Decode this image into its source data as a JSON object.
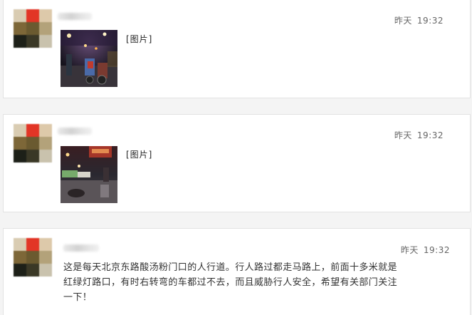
{
  "posts": [
    {
      "time_day": "昨天",
      "time_clock": "19:32",
      "image_label": "[图片]",
      "avatar_colors": [
        "#d9ccb2",
        "#e23526",
        "#ddc9aa",
        "#7d6738",
        "#6a5a30",
        "#b3a27a",
        "#1d2018",
        "#3a3826",
        "#c9c2ad"
      ]
    },
    {
      "time_day": "昨天",
      "time_clock": "19:32",
      "image_label": "[图片]",
      "avatar_colors": [
        "#d9ccb2",
        "#e23526",
        "#ddc9aa",
        "#7d6738",
        "#6a5a30",
        "#b3a27a",
        "#1d2018",
        "#3a3826",
        "#c9c2ad"
      ]
    },
    {
      "time_day": "昨天",
      "time_clock": "19:32",
      "text": "这是每天北京东路酸汤粉门口的人行道。行人路过都走马路上，前面十多米就是红绿灯路口，有时右转弯的车都过不去，而且威胁行人安全，希望有关部门关注一下！",
      "avatar_colors": [
        "#d9ccb2",
        "#e23526",
        "#ddc9aa",
        "#7d6738",
        "#6a5a30",
        "#b3a27a",
        "#1d2018",
        "#3a3826",
        "#c9c2ad"
      ]
    }
  ]
}
